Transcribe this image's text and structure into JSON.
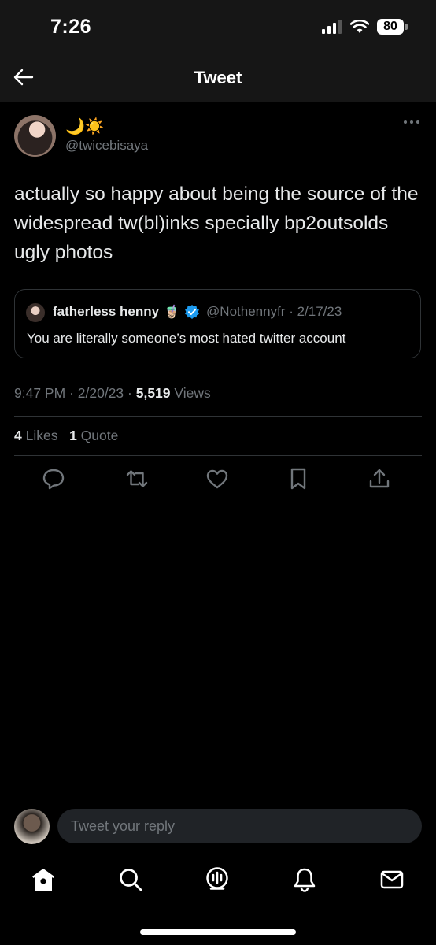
{
  "status_bar": {
    "time": "7:26",
    "battery": "80",
    "icons": [
      "signal-icon",
      "wifi-icon",
      "battery-icon"
    ]
  },
  "header": {
    "title": "Tweet",
    "back_icon": "back-arrow-icon"
  },
  "tweet": {
    "display_name": "🌙☀️",
    "handle": "@twicebisaya",
    "text": "actually so happy about being the source of the widespread tw(bl)inks specially bp2outsolds ugly photos",
    "time": "9:47 PM",
    "date": "2/20/23",
    "views_count": "5,519",
    "views_label": "Views",
    "likes_count": "4",
    "likes_label": "Likes",
    "quotes_count": "1",
    "quotes_label": "Quote",
    "separator": "·"
  },
  "quoted_tweet": {
    "name": "fatherless henny",
    "emoji": "🧋",
    "handle": "@Nothennyfr",
    "separator": "·",
    "date": "2/17/23",
    "text": "You are literally someone’s most hated twitter account"
  },
  "actions": [
    "reply-icon",
    "retweet-icon",
    "like-icon",
    "bookmark-icon",
    "share-icon"
  ],
  "reply": {
    "placeholder": "Tweet your reply"
  },
  "tabs": [
    "home-icon",
    "search-icon",
    "spaces-icon",
    "notifications-icon",
    "messages-icon"
  ],
  "colors": {
    "background": "#000000",
    "muted": "#71767b",
    "text": "#e7e9ea",
    "verified": "#1d9bf0",
    "divider": "#2f3336"
  }
}
